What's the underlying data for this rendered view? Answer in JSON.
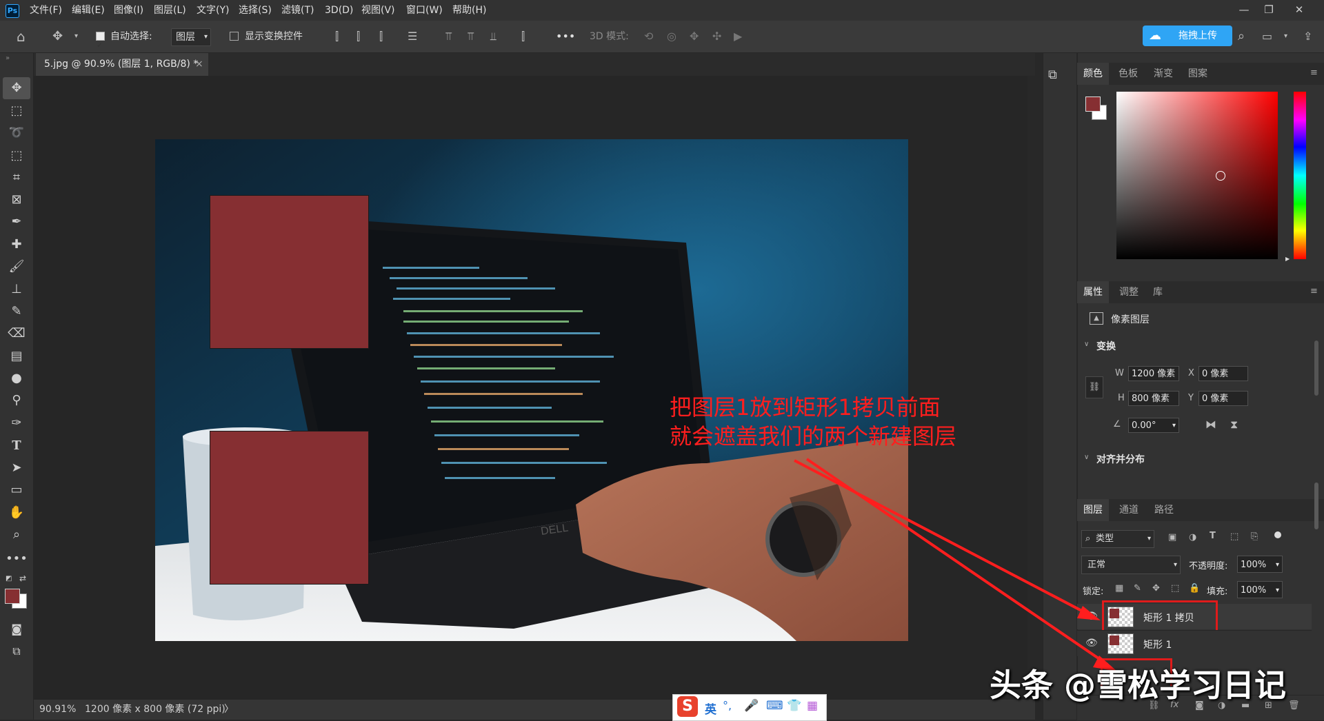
{
  "menubar": {
    "logo": "Ps",
    "items": [
      "文件(F)",
      "编辑(E)",
      "图像(I)",
      "图层(L)",
      "文字(Y)",
      "选择(S)",
      "滤镜(T)",
      "3D(D)",
      "视图(V)",
      "窗口(W)",
      "帮助(H)"
    ],
    "window_controls": [
      "—",
      "❐",
      "✕"
    ]
  },
  "options": {
    "auto_select_label": "自动选择:",
    "auto_select_value": "图层",
    "show_transform_label": "显示变换控件",
    "more": "•••",
    "mode_3d_label": "3D 模式:",
    "upload_label": "拖拽上传"
  },
  "document": {
    "tab_title": "5.jpg @ 90.9% (图层 1, RGB/8) *",
    "close": "×"
  },
  "canvas": {
    "annotation_line1": "把图层1放到矩形1拷贝前面",
    "annotation_line2": "就会遮盖我们的两个新建图层",
    "rect_color": "#862f32",
    "laptop_brand": "DELL"
  },
  "status": {
    "zoom": "90.91%",
    "doc_info": "1200 像素 x 800 像素 (72 ppi)",
    "arrow": "〉"
  },
  "color_panel": {
    "tabs": [
      "颜色",
      "色板",
      "渐变",
      "图案"
    ],
    "foreground": "#862f32"
  },
  "properties_panel": {
    "tabs": [
      "属性",
      "调整",
      "库"
    ],
    "type_label": "像素图层",
    "transform_title": "变换",
    "w_label": "W",
    "w_value": "1200 像素",
    "h_label": "H",
    "h_value": "800 像素",
    "x_label": "X",
    "x_value": "0 像素",
    "y_label": "Y",
    "y_value": "0 像素",
    "angle_value": "0.00°",
    "align_title": "对齐并分布"
  },
  "layers_panel": {
    "tabs": [
      "图层",
      "通道",
      "路径"
    ],
    "filter_label": "类型",
    "blend_mode": "正常",
    "opacity_label": "不透明度:",
    "opacity_value": "100%",
    "lock_label": "锁定:",
    "fill_label": "填充:",
    "fill_value": "100%",
    "layers": [
      {
        "name": "矩形 1 拷贝",
        "highlighted": true
      },
      {
        "name": "矩形 1",
        "highlighted": false
      }
    ],
    "footer_icons": [
      "link-icon",
      "fx-icon",
      "mask-icon",
      "adjustment-icon",
      "group-icon",
      "new-layer-icon",
      "trash-icon"
    ],
    "fx_label": "fx"
  },
  "ime_bar": {
    "logo": "S",
    "lang": "英"
  },
  "watermark": "头条 @雪松学习日记"
}
